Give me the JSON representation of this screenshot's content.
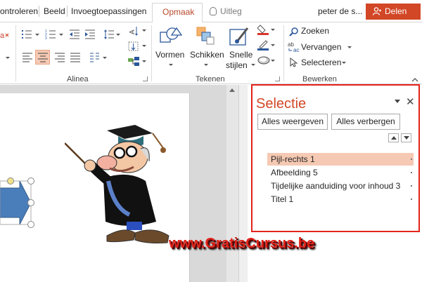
{
  "tabs": {
    "items": [
      "ontroleren",
      "Beeld",
      "Invoegtoepassingen"
    ],
    "active": "Opmaak",
    "tell_me": "Uitleg",
    "user": "peter de s...",
    "share": "Delen"
  },
  "ribbon": {
    "groups": {
      "paragraph": "Alinea",
      "drawing": "Tekenen",
      "editing": "Bewerken"
    },
    "drawing": {
      "shapes": "Vormen",
      "arrange": "Schikken",
      "quick_styles_line1": "Snelle",
      "quick_styles_line2": "stijlen"
    },
    "editing": {
      "find": "Zoeken",
      "replace": "Vervangen",
      "select": "Selecteren"
    },
    "colors": {
      "accent": "#d24726",
      "highlight": "#f5c9b3",
      "outline": "#e2231a"
    }
  },
  "selection_pane": {
    "title": "Selectie",
    "show_all": "Alles weergeven",
    "hide_all": "Alles verbergen",
    "items": [
      {
        "label": "Pijl-rechts 1",
        "selected": true
      },
      {
        "label": "Afbeelding 5",
        "selected": false
      },
      {
        "label": "Tijdelijke aanduiding voor inhoud 3",
        "selected": false
      },
      {
        "label": "Titel 1",
        "selected": false
      }
    ]
  },
  "watermark": "www.GratisCursus.be"
}
